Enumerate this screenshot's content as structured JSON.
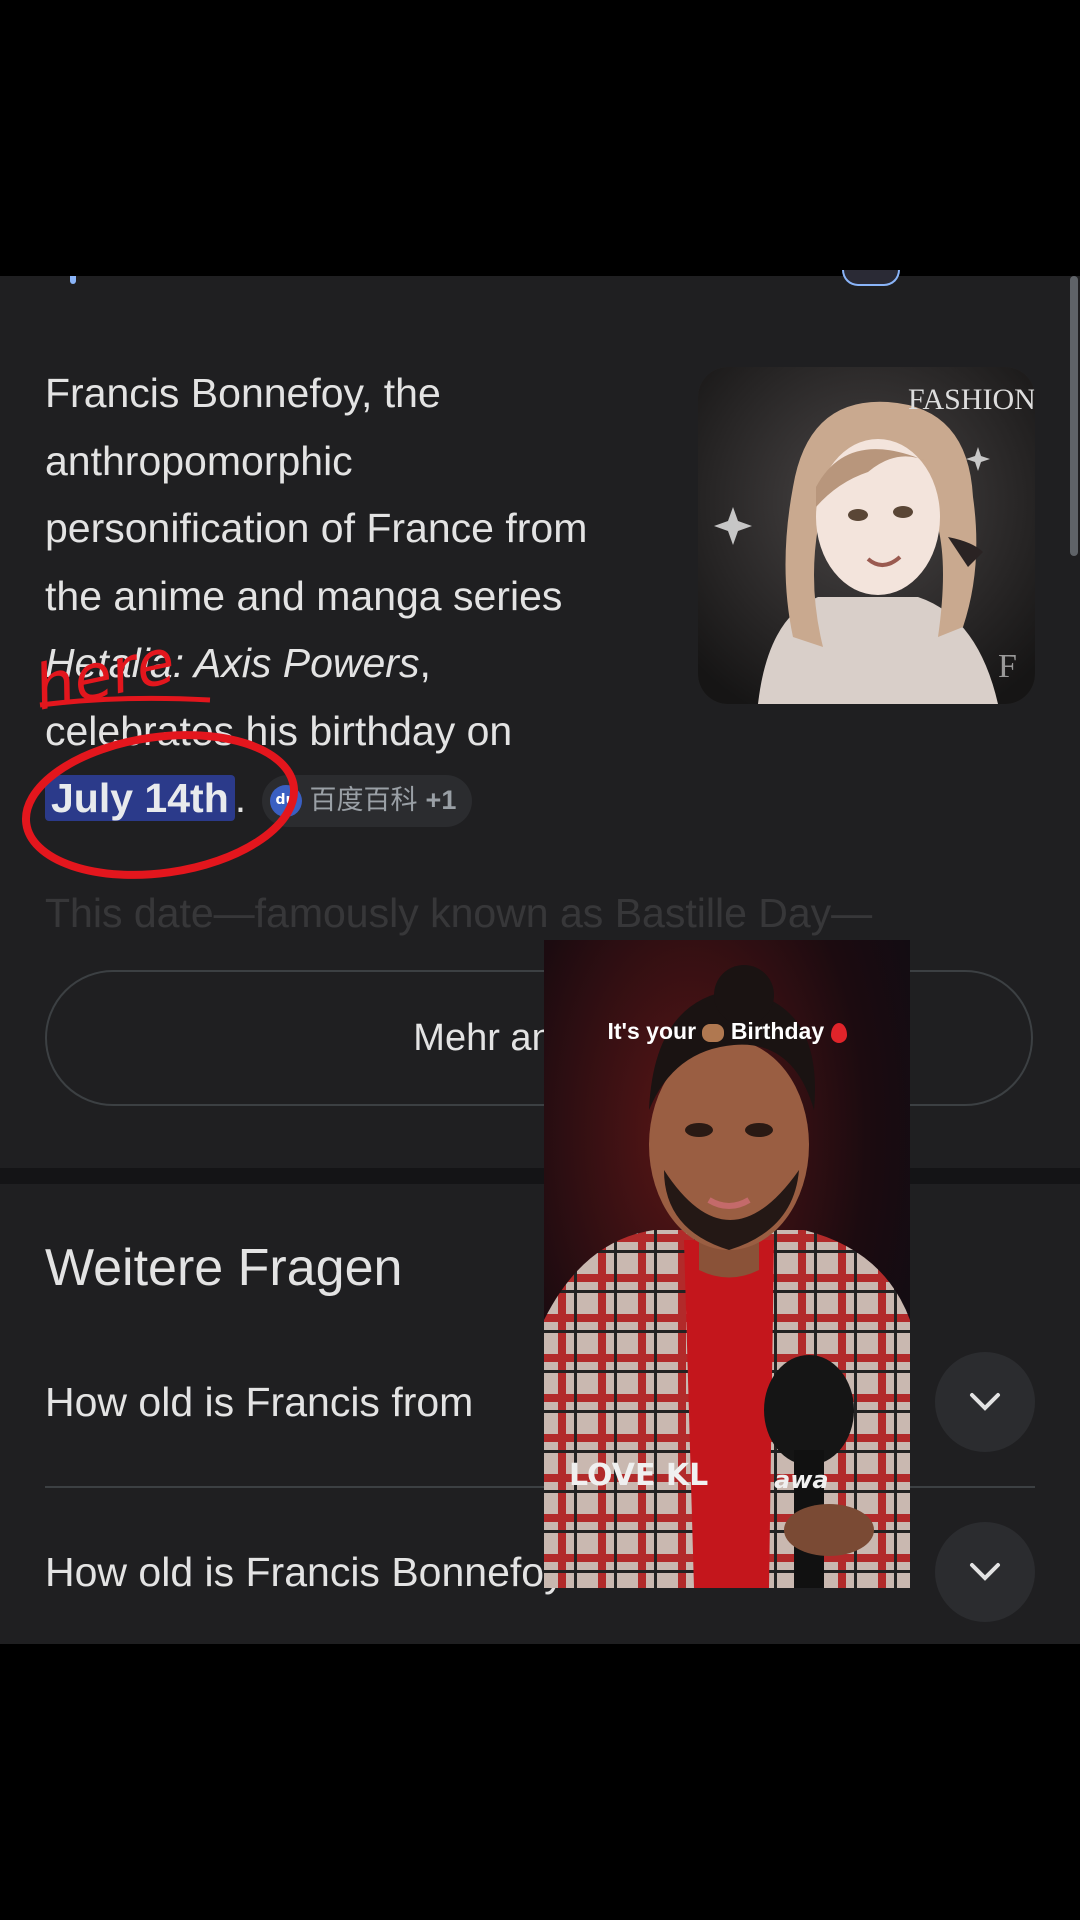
{
  "answer": {
    "text_before": "Francis Bonnefoy, the anthropomorphic personification of France from the anime and manga series ",
    "series_title": "Hetalia: Axis Powers",
    "text_after": ", celebrates his birthday on ",
    "highlight_date": "July 14th",
    "period": ".",
    "source_chip": {
      "label": "百度百科",
      "extra": "+1",
      "icon_text": "du"
    }
  },
  "thumbnail": {
    "watermark": "FASHION",
    "corner_letter": "F"
  },
  "faded_text": "This date—famously known as Bastille Day—",
  "more_button": {
    "label": "Mehr anzeigen"
  },
  "related": {
    "title": "Weitere Fragen",
    "items": [
      {
        "question": "How old is Francis from"
      },
      {
        "question": "How old is Francis Bonnefoy"
      }
    ]
  },
  "overlay": {
    "caption_before": "It's your",
    "caption_after": "Birthday",
    "shirt_text": "LOVE KL",
    "shirt_text_2": "awa"
  },
  "annotation": {
    "handwritten": "here"
  },
  "colors": {
    "background": "#1f1f21",
    "highlight": "#2b3a8a",
    "annotation": "#e3161d"
  }
}
